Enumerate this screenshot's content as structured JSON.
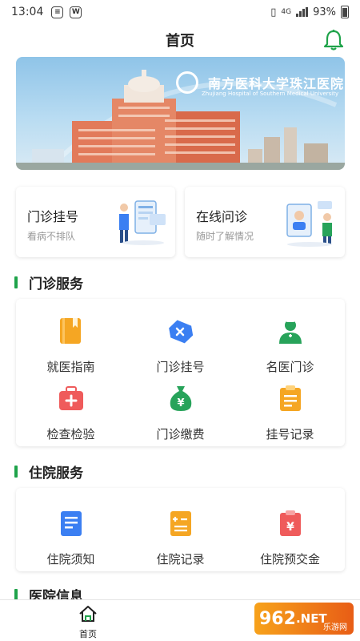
{
  "status_bar": {
    "time": "13:04",
    "network": "4G",
    "battery": "93%"
  },
  "header": {
    "title": "首页"
  },
  "banner": {
    "hospital_name": "南方医科大学珠江医院",
    "hospital_name_en": "Zhujiang Hospital of Southern Medical University"
  },
  "quick_cards": [
    {
      "title": "门诊挂号",
      "subtitle": "看病不排队"
    },
    {
      "title": "在线问诊",
      "subtitle": "随时了解情况"
    }
  ],
  "outpatient": {
    "section_title": "门诊服务",
    "items": [
      {
        "label": "就医指南",
        "icon": "book-icon",
        "color": "#f5a623"
      },
      {
        "label": "门诊挂号",
        "icon": "tag-icon",
        "color": "#3b7ff2"
      },
      {
        "label": "名医门诊",
        "icon": "doctor-icon",
        "color": "#27a35a"
      },
      {
        "label": "检查检验",
        "icon": "medical-kit-icon",
        "color": "#ef5b5b"
      },
      {
        "label": "门诊缴费",
        "icon": "money-bag-icon",
        "color": "#27a35a"
      },
      {
        "label": "挂号记录",
        "icon": "clipboard-icon",
        "color": "#f5a623"
      }
    ]
  },
  "inpatient": {
    "section_title": "住院服务",
    "items": [
      {
        "label": "住院须知",
        "icon": "document-icon",
        "color": "#3b7ff2"
      },
      {
        "label": "住院记录",
        "icon": "calculator-icon",
        "color": "#f5a623"
      },
      {
        "label": "住院预交金",
        "icon": "yuan-clipboard-icon",
        "color": "#ef5b5b"
      }
    ]
  },
  "hospital_info": {
    "section_title": "医院信息"
  },
  "tabbar": {
    "home_label": "首页"
  },
  "watermark": {
    "brand": "962",
    "suffix": ".NET",
    "sub": "乐游网"
  }
}
